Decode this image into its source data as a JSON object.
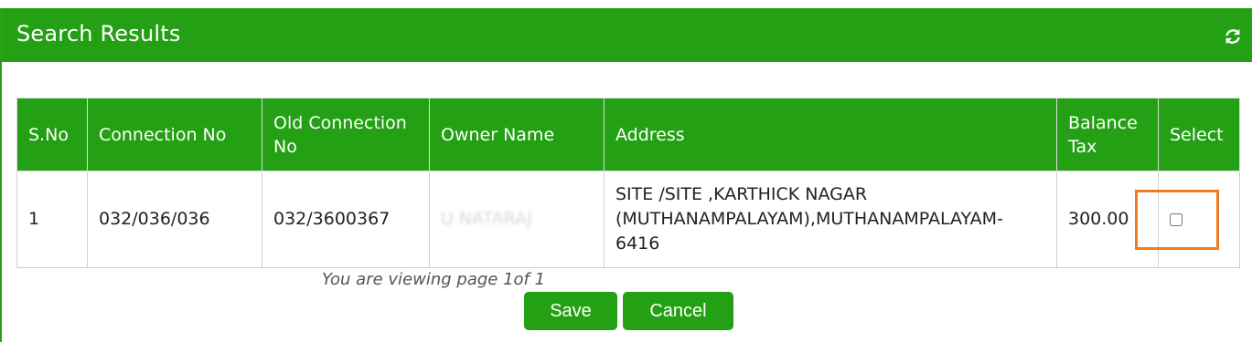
{
  "panel": {
    "title": "Search Results",
    "refresh_icon": "refresh-icon"
  },
  "table": {
    "headers": [
      "S.No",
      "Connection No",
      "Old Connection No",
      "Owner Name",
      "Address",
      "Balance Tax",
      "Select"
    ],
    "rows": [
      {
        "sno": "1",
        "connection_no": "032/036/036",
        "old_connection_no": "032/3600367",
        "owner_name": "U NATARAJ",
        "address": "SITE /SITE ,KARTHICK NAGAR (MUTHANAMPALAYAM),MUTHANAMPALAYAM-6416",
        "balance_tax": "300.00",
        "selected": false
      }
    ]
  },
  "pager": {
    "text": "You are viewing page 1of 1"
  },
  "actions": {
    "save_label": "Save",
    "cancel_label": "Cancel"
  },
  "colors": {
    "header_green": "#23a013",
    "highlight_orange": "#f07b22"
  }
}
